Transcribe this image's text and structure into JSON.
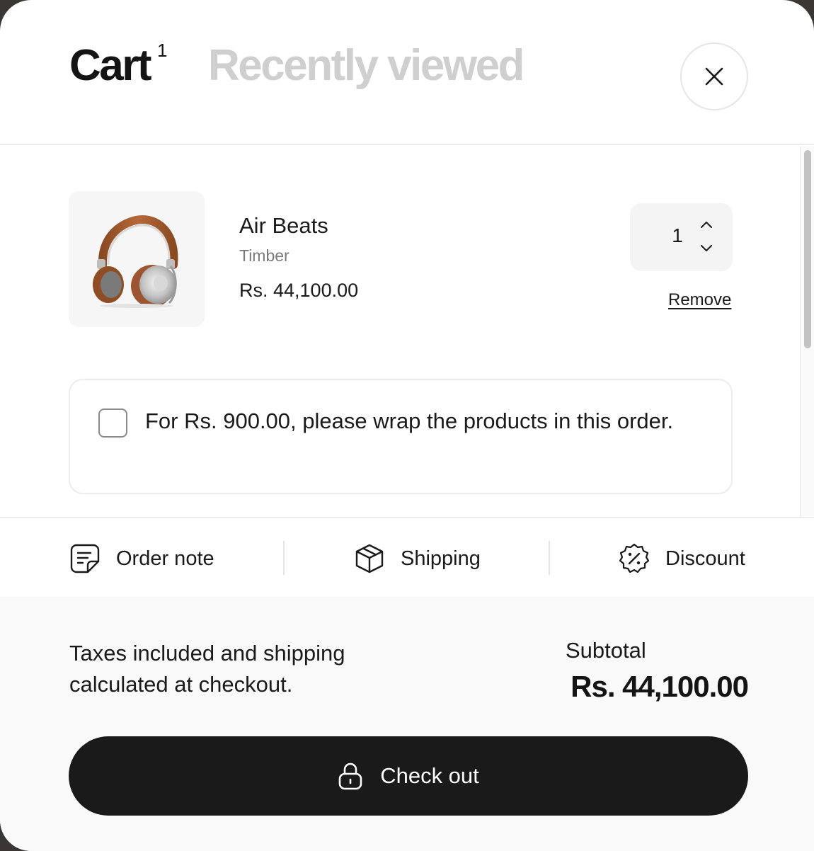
{
  "header": {
    "tab_cart": "Cart",
    "cart_count": "1",
    "tab_recent": "Recently viewed",
    "close_icon": "close-icon"
  },
  "cart": {
    "items": [
      {
        "title": "Air Beats",
        "variant": "Timber",
        "price": "Rs. 44,100.00",
        "quantity": "1",
        "remove_label": "Remove",
        "image_icon": "headphones-image"
      }
    ],
    "gift_wrap": {
      "checked": false,
      "text": "For Rs. 900.00, please wrap the products in this order."
    }
  },
  "actions": [
    {
      "label": "Order note",
      "icon": "order-note-icon"
    },
    {
      "label": "Shipping",
      "icon": "package-icon"
    },
    {
      "label": "Discount",
      "icon": "discount-badge-icon"
    }
  ],
  "footer": {
    "tax_note": "Taxes included and shipping calculated at checkout.",
    "subtotal_label": "Subtotal",
    "subtotal_value": "Rs. 44,100.00",
    "checkout_label": "Check out",
    "checkout_icon": "lock-icon"
  },
  "colors": {
    "primary_button": "#1a1a1a",
    "muted_tab": "#cfcfcf",
    "footer_bg": "#f9f9f9"
  }
}
